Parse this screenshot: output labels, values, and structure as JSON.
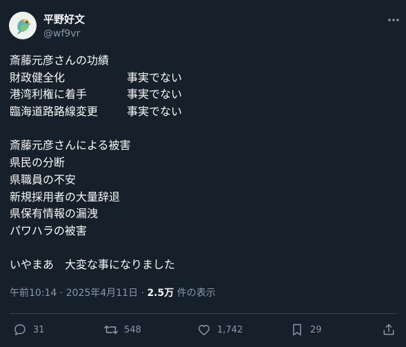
{
  "author": {
    "name": "平野好文",
    "handle": "@wf9vr"
  },
  "body": {
    "title": "斎藤元彦さんの功績",
    "achievements": [
      {
        "item": "財政健全化",
        "verdict": "事実でない"
      },
      {
        "item": "港湾利権に着手",
        "verdict": "事実でない"
      },
      {
        "item": "臨海道路路線変更",
        "verdict": "事実でない"
      }
    ],
    "harm_title": "斎藤元彦さんによる被害",
    "harms": [
      "県民の分断",
      "県職員の不安",
      "新規採用者の大量辞退",
      "県保有情報の漏洩",
      "パワハラの被害"
    ],
    "closing": "いやまあ　大変な事になりました"
  },
  "meta": {
    "time": "午前10:14",
    "sep": " · ",
    "date": "2025年4月11日",
    "views": "2.5万",
    "views_label": " 件の表示"
  },
  "actions": {
    "replies": "31",
    "reposts": "548",
    "likes": "1,742",
    "bookmarks": "29"
  },
  "icons": [
    "bird-avatar",
    "more-icon",
    "reply-icon",
    "repost-icon",
    "like-icon",
    "bookmark-icon",
    "share-icon"
  ]
}
